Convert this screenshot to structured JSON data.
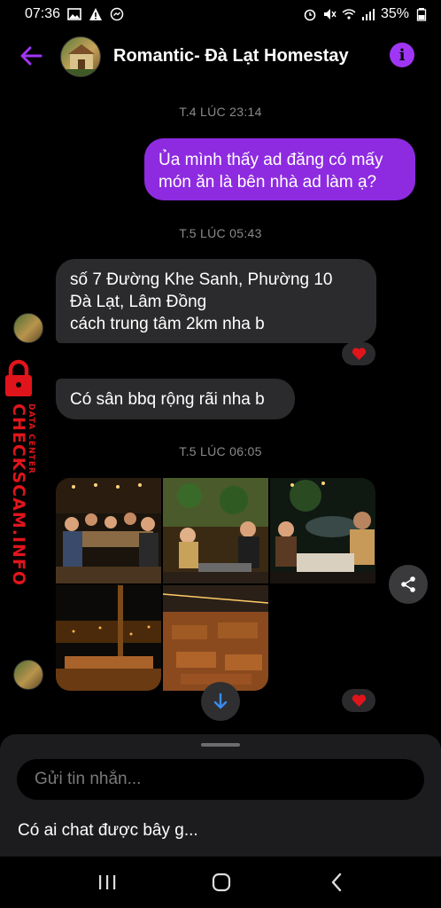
{
  "status_bar": {
    "time": "07:36",
    "battery": "35%"
  },
  "header": {
    "title": "Romantic- Đà Lạt Homestay",
    "info_glyph": "i"
  },
  "timestamps": {
    "t1": "T.4 LÚC 23:14",
    "t2": "T.5 LÚC 05:43",
    "t3": "T.5 LÚC 06:05"
  },
  "messages": {
    "outgoing_1": {
      "lines": [
        "Ủa mình thấy ad đăng có mấy",
        "món ăn là bên nhà ad làm ạ?"
      ]
    },
    "incoming_1": {
      "lines": [
        "số 7 Đường Khe Sanh, Phường 10",
        "Đà Lạt, Lâm Đồng",
        "cách trung tâm 2km nha b"
      ]
    },
    "incoming_2": {
      "text": "Có sân bbq rộng rãi nha b"
    }
  },
  "composer": {
    "placeholder": "Gửi tin nhắn...",
    "suggestion": "Có ai chat được bây g..."
  },
  "watermark": {
    "main": "CHECKSCAM.INFO",
    "sub": "DATA CENTER"
  },
  "colors": {
    "accent": "#8e2be0",
    "info": "#a036f5",
    "reaction": "#e0151b"
  }
}
